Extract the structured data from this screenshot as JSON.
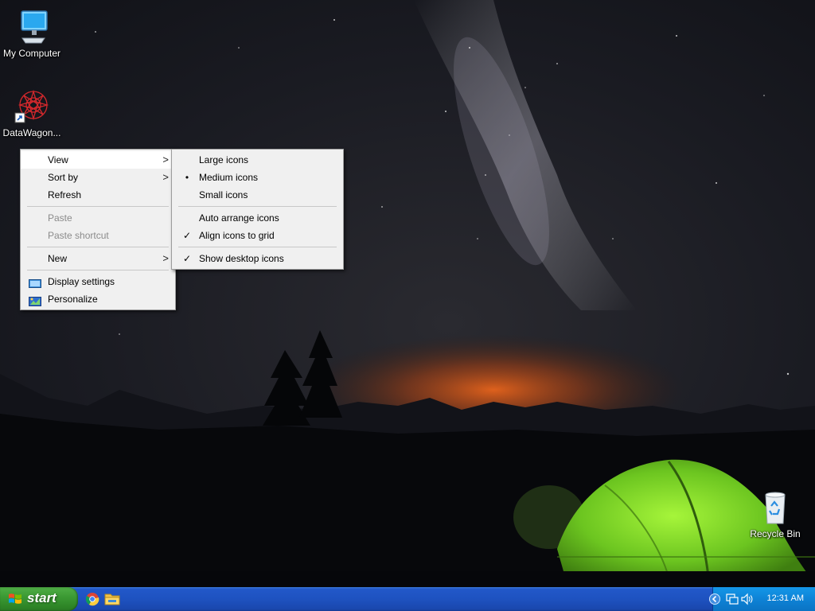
{
  "desktop": {
    "icons": [
      {
        "label": "My Computer",
        "icon": "my-computer-icon"
      },
      {
        "label": "DataWagon...",
        "icon": "datawagon-icon"
      },
      {
        "label": "Recycle Bin",
        "icon": "recycle-bin-icon"
      }
    ]
  },
  "context_menu": {
    "items": [
      {
        "label": "View",
        "submenu": true,
        "highlighted": true
      },
      {
        "label": "Sort by",
        "submenu": true
      },
      {
        "label": "Refresh"
      },
      {
        "label": "Paste",
        "disabled": true
      },
      {
        "label": "Paste shortcut",
        "disabled": true
      },
      {
        "label": "New",
        "submenu": true
      },
      {
        "label": "Display settings",
        "icon": "display-settings-icon"
      },
      {
        "label": "Personalize",
        "icon": "personalize-icon"
      }
    ],
    "submenu_arrow": ">"
  },
  "view_submenu": {
    "items": [
      {
        "label": "Large icons"
      },
      {
        "label": "Medium icons",
        "mark": "•"
      },
      {
        "label": "Small icons"
      },
      {
        "label": "Auto arrange icons"
      },
      {
        "label": "Align icons to grid",
        "mark": "✓"
      },
      {
        "label": "Show desktop icons",
        "mark": "✓"
      }
    ]
  },
  "taskbar": {
    "start_label": "start",
    "quick_launch": [
      "chrome-icon",
      "file-explorer-icon"
    ],
    "tray_icons": [
      "tray-expand-icon",
      "network-icon",
      "volume-icon"
    ],
    "clock": "12:31 AM"
  },
  "colors": {
    "menu_bg": "#f0f0f0",
    "menu_highlight": "#ffffff",
    "taskbar": "#2258c9",
    "start": "#3c9a34",
    "tray": "#0e83d6"
  }
}
